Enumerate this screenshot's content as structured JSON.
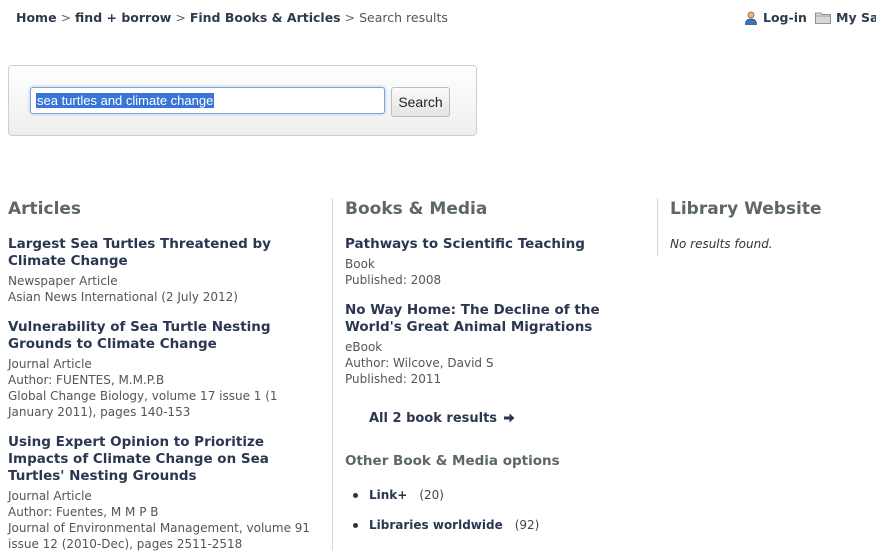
{
  "breadcrumb": {
    "home": "Home",
    "find_borrow": "find + borrow",
    "find_books": "Find Books & Articles",
    "separator": ">",
    "current": "Search results"
  },
  "topnav": {
    "login": "Log-in",
    "my_saved": "My Save"
  },
  "search": {
    "query": "sea turtles and climate change",
    "button": "Search"
  },
  "articles": {
    "heading": "Articles",
    "results": [
      {
        "title": "Largest Sea Turtles Threatened by Climate Change",
        "type": "Newspaper Article",
        "source": "Asian News International (2 July 2012)"
      },
      {
        "title": "Vulnerability of Sea Turtle Nesting Grounds to Climate Change",
        "type": "Journal Article",
        "author": "Author: FUENTES, M.M.P.B",
        "source": "Global Change Biology, volume 17 issue 1 (1 January 2011), pages 140-153"
      },
      {
        "title": "Using Expert Opinion to Prioritize Impacts of Climate Change on Sea Turtles' Nesting Grounds",
        "type": "Journal Article",
        "author": "Author: Fuentes, M M P B",
        "source": "Journal of Environmental Management, volume 91 issue 12 (2010-Dec), pages 2511-2518"
      }
    ]
  },
  "books": {
    "heading": "Books & Media",
    "results": [
      {
        "title": "Pathways to Scientific Teaching",
        "type": "Book",
        "published": "Published: 2008"
      },
      {
        "title": "No Way Home: The Decline of the World's Great Animal Migrations",
        "type": "eBook",
        "author": "Author: Wilcove, David S",
        "published": "Published: 2011"
      }
    ],
    "all_results": "All 2 book results",
    "other_heading": "Other Book & Media options",
    "options": [
      {
        "label": "Link+",
        "count": "(20)"
      },
      {
        "label": "Libraries worldwide",
        "count": "(92)"
      }
    ]
  },
  "website": {
    "heading": "Library Website",
    "no_results": "No results found."
  },
  "colors": {
    "link": "#2b3650",
    "heading": "#5d6860",
    "selection": "#3875d7"
  }
}
